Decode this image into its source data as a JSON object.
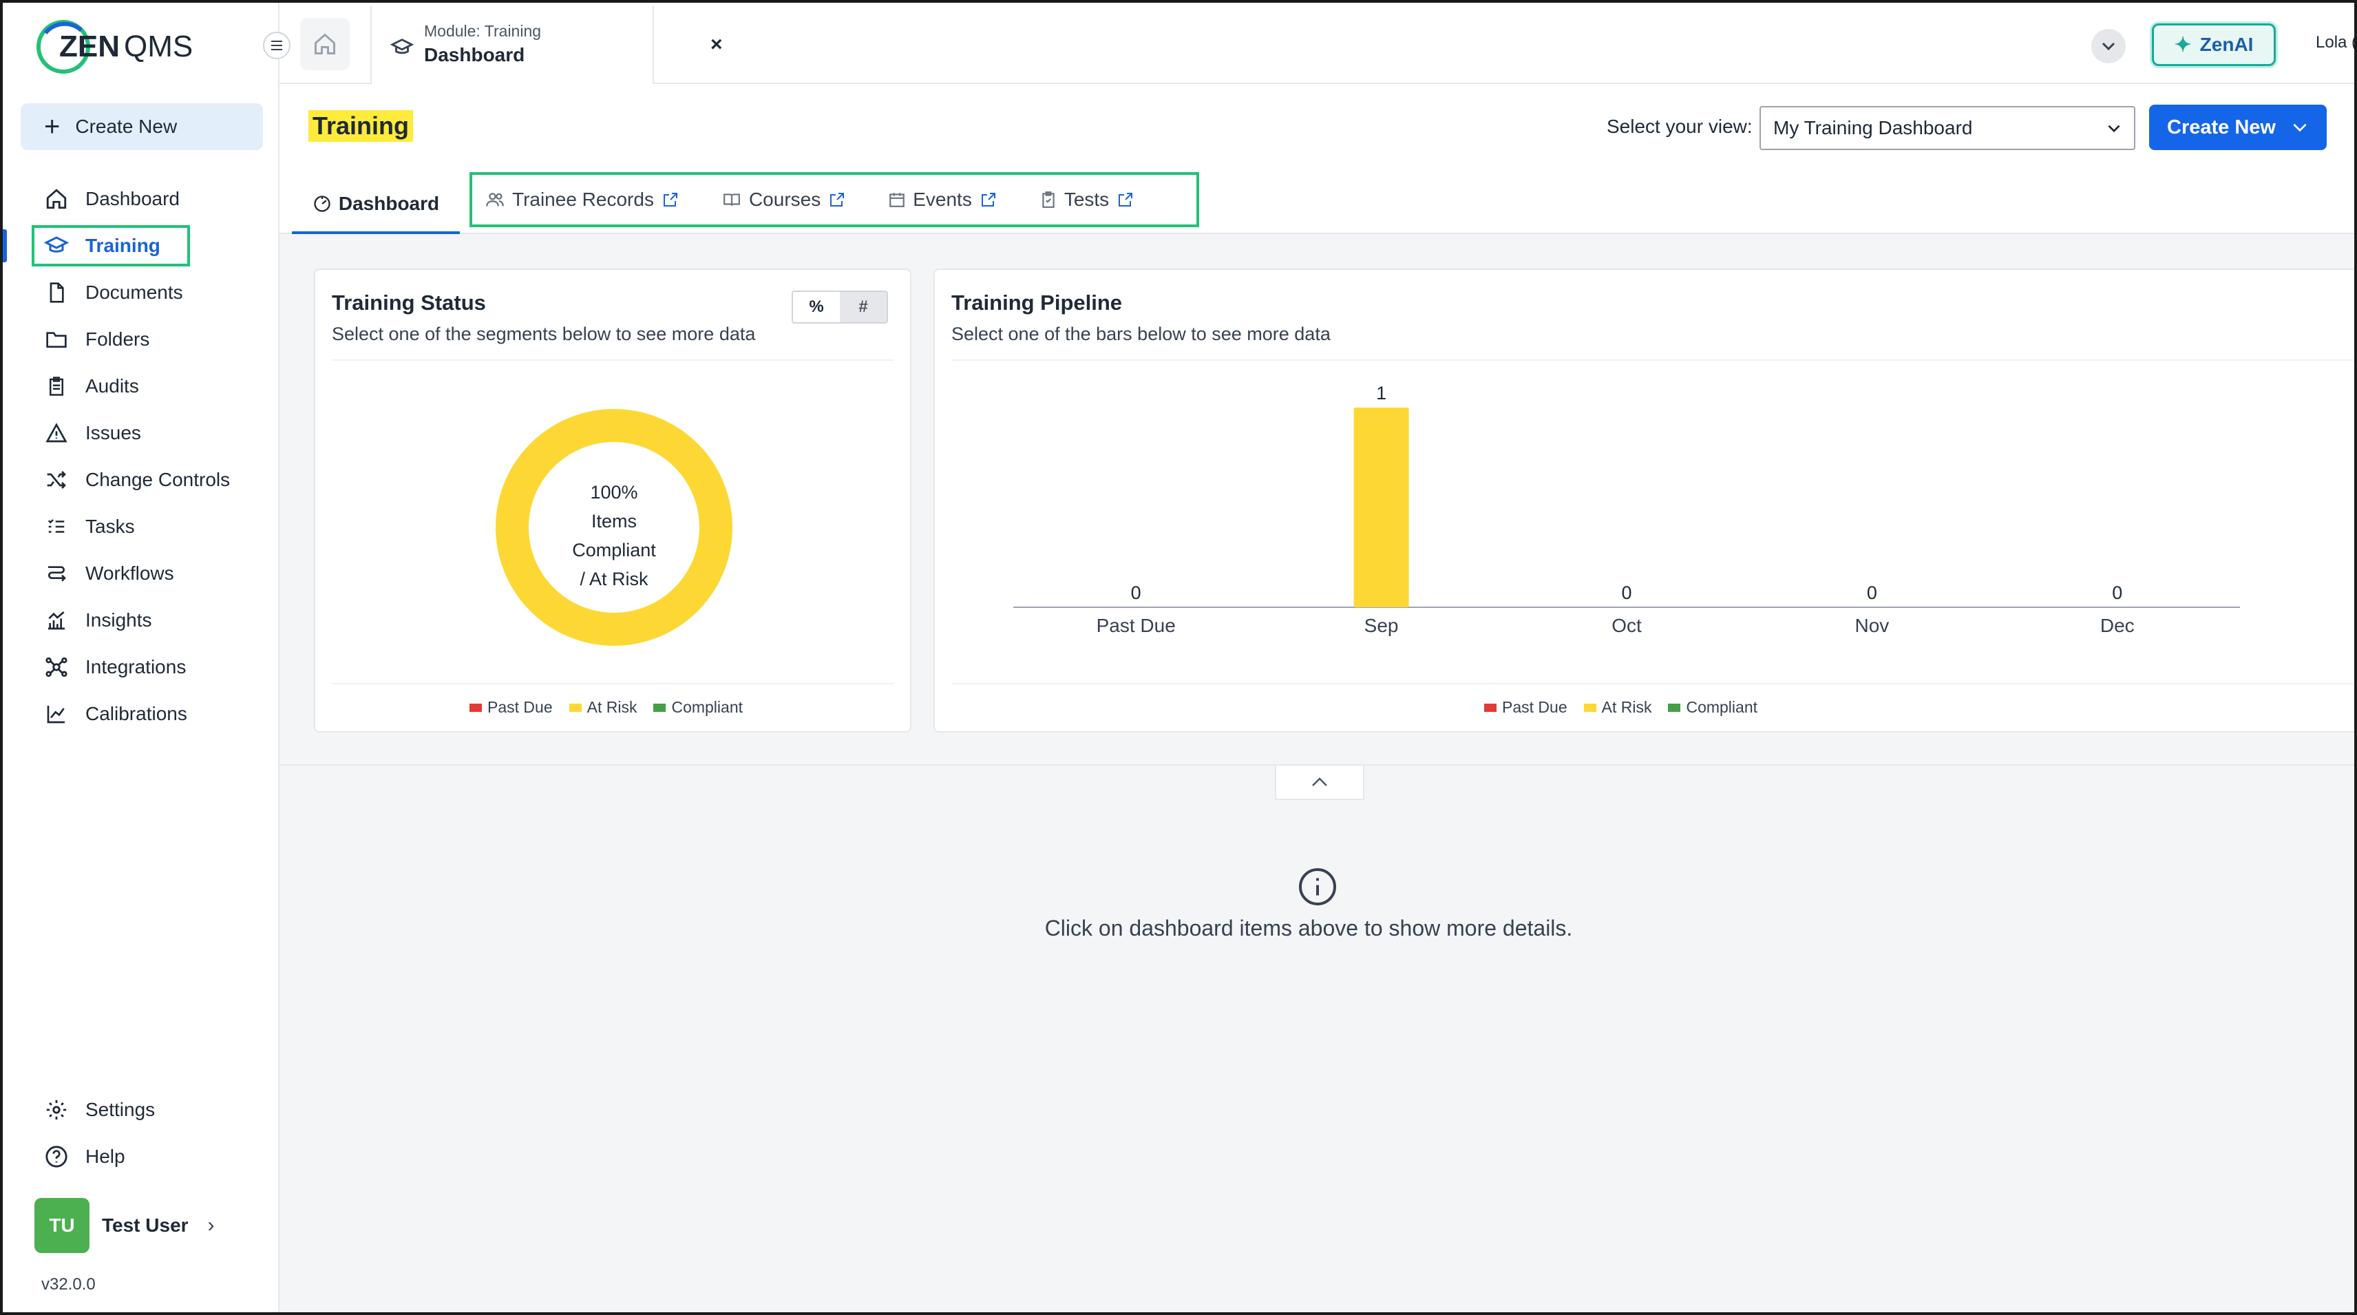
{
  "app": {
    "logo_text": "ZENQMS"
  },
  "sidebar": {
    "create_label": "Create New",
    "items": [
      {
        "label": "Dashboard",
        "icon": "home-icon"
      },
      {
        "label": "Training",
        "icon": "graduation-cap-icon",
        "active": true
      },
      {
        "label": "Documents",
        "icon": "document-icon"
      },
      {
        "label": "Folders",
        "icon": "folder-icon"
      },
      {
        "label": "Audits",
        "icon": "clipboard-icon"
      },
      {
        "label": "Issues",
        "icon": "warning-icon"
      },
      {
        "label": "Change Controls",
        "icon": "shuffle-icon"
      },
      {
        "label": "Tasks",
        "icon": "task-list-icon"
      },
      {
        "label": "Workflows",
        "icon": "workflow-icon"
      },
      {
        "label": "Insights",
        "icon": "bar-chart-icon"
      },
      {
        "label": "Integrations",
        "icon": "integrations-icon"
      },
      {
        "label": "Calibrations",
        "icon": "line-chart-icon"
      }
    ],
    "bottom": [
      {
        "label": "Settings",
        "icon": "gear-icon"
      },
      {
        "label": "Help",
        "icon": "help-icon"
      }
    ],
    "user": {
      "initials": "TU",
      "name": "Test User"
    },
    "version": "v32.0.0"
  },
  "topbar": {
    "tab_module": "Module: Training",
    "tab_title": "Dashboard",
    "close": "×",
    "zenai_label": "ZenAI",
    "account": "Lola (THIS IS A ZENQMS TEST ACCOUNT)"
  },
  "header": {
    "title": "Training",
    "view_label": "Select your view:",
    "view_value": "My Training Dashboard",
    "create_label": "Create New",
    "tabs": [
      {
        "label": "Dashboard",
        "active": true
      },
      {
        "label": "Trainee Records"
      },
      {
        "label": "Courses"
      },
      {
        "label": "Events"
      },
      {
        "label": "Tests"
      }
    ]
  },
  "status_card": {
    "title": "Training Status",
    "subtitle": "Select one of the segments below to see more data",
    "toggle": [
      "%",
      "#"
    ],
    "donut_lines": [
      "100%",
      "Items",
      "Compliant",
      "/ At Risk"
    ]
  },
  "pipeline_card": {
    "title": "Training Pipeline",
    "subtitle": "Select one of the bars below to see more data"
  },
  "legend": [
    {
      "label": "Past Due",
      "color": "#e53935"
    },
    {
      "label": "At Risk",
      "color": "#fdd835"
    },
    {
      "label": "Compliant",
      "color": "#43a047"
    }
  ],
  "details": {
    "message": "Click on dashboard items above to show more details."
  },
  "chart_data": [
    {
      "type": "pie",
      "labels": [
        "Past Due",
        "At Risk",
        "Compliant"
      ],
      "values": [
        0,
        100,
        0
      ],
      "center_text": "100% Items Compliant / At Risk"
    },
    {
      "type": "bar",
      "title": "Training Pipeline",
      "categories": [
        "Past Due",
        "Sep",
        "Oct",
        "Nov",
        "Dec"
      ],
      "values": [
        0,
        1,
        0,
        0,
        0
      ],
      "ylim": [
        0,
        1
      ]
    }
  ],
  "colors": {
    "accent": "#1a63d8",
    "highlight": "#22c177",
    "at_risk": "#fdd835"
  }
}
